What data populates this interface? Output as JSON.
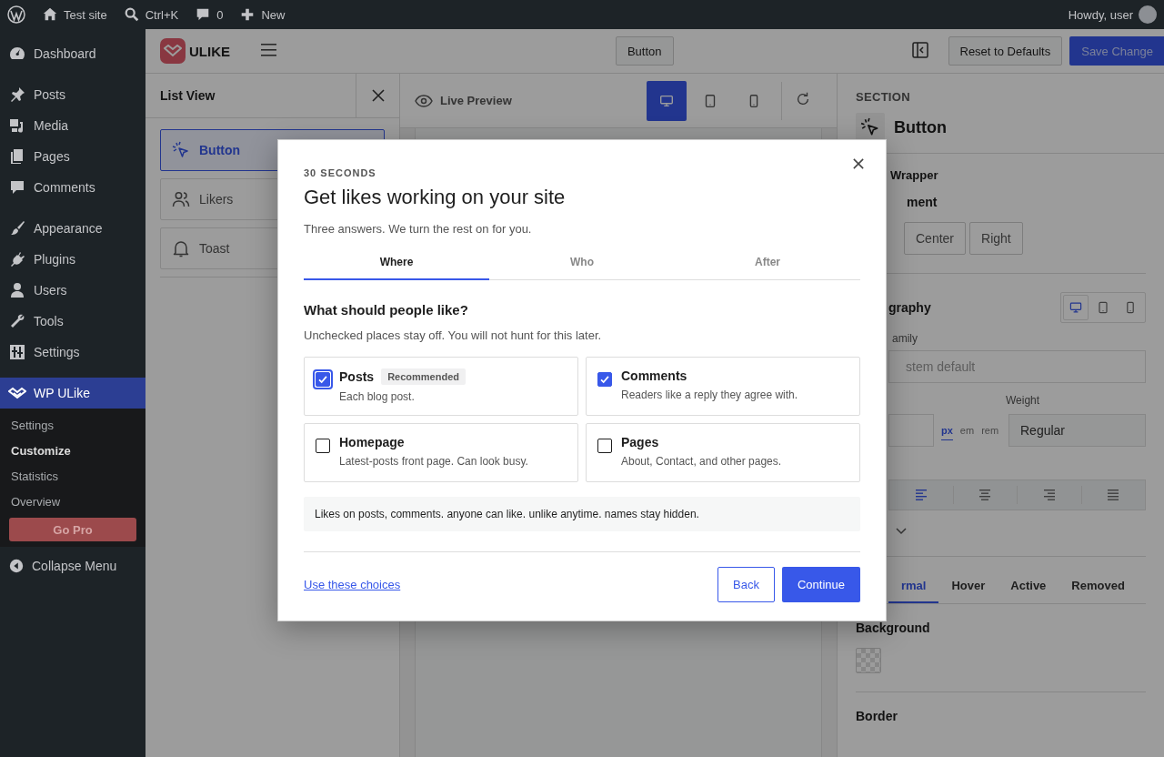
{
  "admin_bar": {
    "items": [
      {
        "label": "Test site"
      },
      {
        "label": "Ctrl+K"
      },
      {
        "label": "0"
      },
      {
        "label": "New"
      }
    ],
    "greeting": "Howdy, user"
  },
  "sidebar": {
    "items": [
      {
        "label": "Dashboard",
        "selected": false
      },
      {
        "label": "Posts",
        "selected": false
      },
      {
        "label": "Media",
        "selected": false
      },
      {
        "label": "Pages",
        "selected": false
      },
      {
        "label": "Comments",
        "selected": false
      },
      {
        "label": "Appearance",
        "selected": false
      },
      {
        "label": "Plugins",
        "selected": false
      },
      {
        "label": "Users",
        "selected": false
      },
      {
        "label": "Tools",
        "selected": false
      },
      {
        "label": "Settings",
        "selected": false
      },
      {
        "label": "WP ULike",
        "selected": true
      }
    ],
    "submenu": [
      {
        "label": "Settings",
        "selected": false
      },
      {
        "label": "Customize",
        "selected": true
      },
      {
        "label": "Statistics",
        "selected": false
      },
      {
        "label": "Overview",
        "selected": false
      }
    ],
    "go_pro": "Go Pro",
    "collapse": "Collapse Menu"
  },
  "header": {
    "logo": "ULIKE",
    "element_button": "Button",
    "reset": "Reset to Defaults",
    "save": "Save Change"
  },
  "list_view": {
    "title": "List View",
    "items": [
      {
        "label": "Button",
        "selected": true
      },
      {
        "label": "Likers",
        "selected": false
      },
      {
        "label": "Toast",
        "selected": false
      }
    ]
  },
  "preview": {
    "title": "Live Preview",
    "devices": [
      {
        "selected": true
      },
      {
        "selected": false
      },
      {
        "selected": false
      }
    ]
  },
  "inspector": {
    "section_label": "SECTION",
    "title": "Button",
    "wrapper": "Wrapper",
    "alignment_label": "ment",
    "alignment_options": [
      {
        "label": "Center",
        "selected": false
      },
      {
        "label": "Right",
        "selected": false
      }
    ],
    "typography_label": "graphy",
    "typography_devices": [
      {
        "selected": true
      },
      {
        "selected": false
      },
      {
        "selected": false
      }
    ],
    "family_label": "amily",
    "family_placeholder": "stem default",
    "weight_label": "Weight",
    "units": [
      {
        "label": "px",
        "selected": true
      },
      {
        "label": "em",
        "selected": false
      },
      {
        "label": "rem",
        "selected": false
      }
    ],
    "weight_value": "Regular",
    "text_align": [
      {
        "selected": true
      },
      {
        "selected": false
      },
      {
        "selected": false
      },
      {
        "selected": false
      }
    ],
    "state_tabs": [
      {
        "label": "rmal",
        "selected": true
      },
      {
        "label": "Hover",
        "selected": false
      },
      {
        "label": "Active",
        "selected": false
      },
      {
        "label": "Removed",
        "selected": false
      }
    ],
    "background_label": "Background",
    "border_label": "Border"
  },
  "modal": {
    "eyebrow": "30 SECONDS",
    "title": "Get likes working on your site",
    "subtitle": "Three answers. We turn the rest on for you.",
    "steps": [
      {
        "label": "Where",
        "selected": true
      },
      {
        "label": "Who",
        "selected": false
      },
      {
        "label": "After",
        "selected": false
      }
    ],
    "question": "What should people like?",
    "hint": "Unchecked places stay off. You will not hunt for this later.",
    "options": [
      {
        "title": "Posts",
        "badge": "Recommended",
        "description": "Each blog post.",
        "checked": true,
        "focused": true
      },
      {
        "title": "Comments",
        "description": "Readers like a reply they agree with.",
        "checked": true,
        "focused": false
      },
      {
        "title": "Homepage",
        "description": "Latest-posts front page. Can look busy.",
        "checked": false,
        "focused": false
      },
      {
        "title": "Pages",
        "description": "About, Contact, and other pages.",
        "checked": false,
        "focused": false
      }
    ],
    "summary": "Likes on posts, comments. anyone can like. unlike anytime. names stay hidden.",
    "link": "Use these choices",
    "back": "Back",
    "continue": "Continue"
  }
}
